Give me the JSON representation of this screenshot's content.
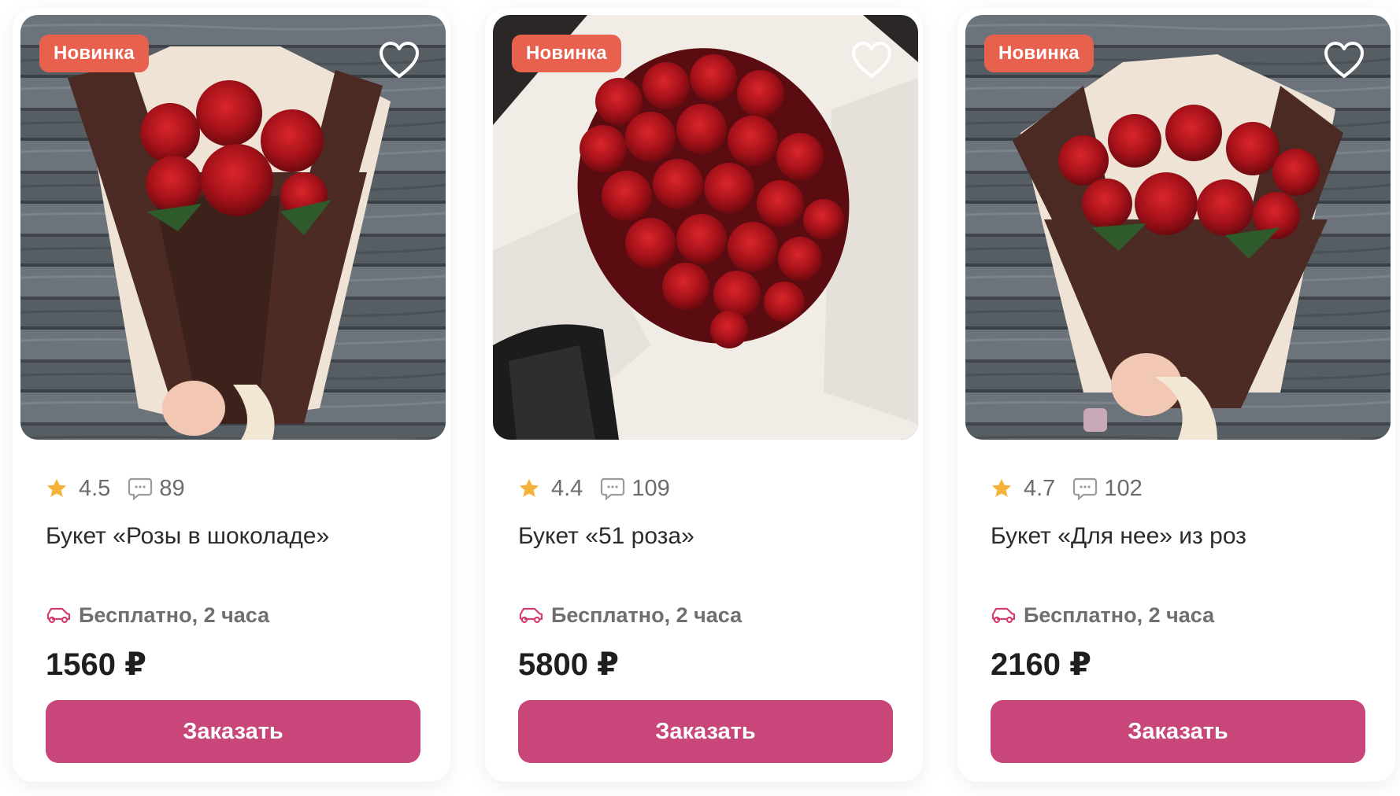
{
  "colors": {
    "badge": "#e8614f",
    "button": "#c9467a",
    "star": "#f3b23b",
    "delivery_icon": "#d23e6f"
  },
  "cards": [
    {
      "badge": "Новинка",
      "rating": "4.5",
      "reviews": "89",
      "title": "Букет «Розы в шоколаде»",
      "delivery": "Бесплатно, 2 часа",
      "price": "1560 ₽",
      "button": "Заказать",
      "icons": [
        "heart-icon",
        "star-icon",
        "comment-icon",
        "car-icon"
      ]
    },
    {
      "badge": "Новинка",
      "rating": "4.4",
      "reviews": "109",
      "title": "Букет «51 роза»",
      "delivery": "Бесплатно, 2 часа",
      "price": "5800 ₽",
      "button": "Заказать",
      "icons": [
        "heart-icon",
        "star-icon",
        "comment-icon",
        "car-icon"
      ]
    },
    {
      "badge": "Новинка",
      "rating": "4.7",
      "reviews": "102",
      "title": "Букет «Для нее» из роз",
      "delivery": "Бесплатно, 2 часа",
      "price": "2160 ₽",
      "button": "Заказать",
      "icons": [
        "heart-icon",
        "star-icon",
        "comment-icon",
        "car-icon"
      ]
    }
  ]
}
